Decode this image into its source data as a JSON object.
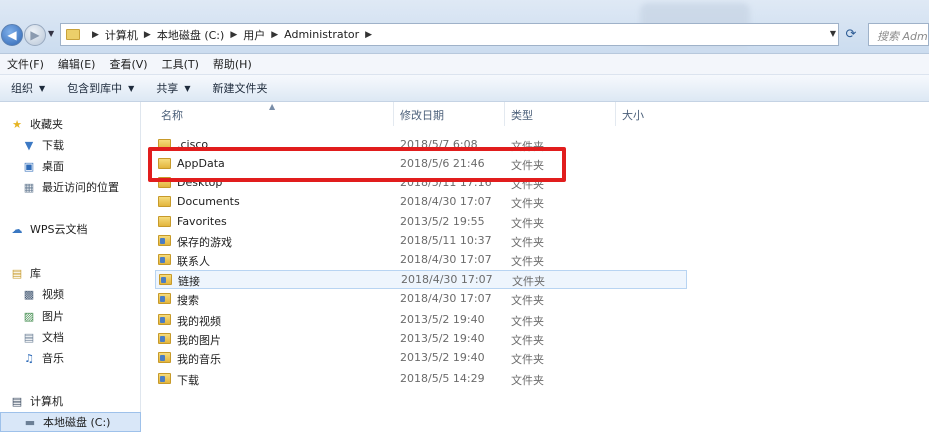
{
  "address_bar": {
    "crumbs": [
      "计算机",
      "本地磁盘 (C:)",
      "用户",
      "Administrator"
    ],
    "search_placeholder": "搜索 Administrator"
  },
  "menu": [
    "文件(F)",
    "编辑(E)",
    "查看(V)",
    "工具(T)",
    "帮助(H)"
  ],
  "commands": [
    {
      "label": "组织",
      "dropdown": true
    },
    {
      "label": "包含到库中",
      "dropdown": true
    },
    {
      "label": "共享",
      "dropdown": true
    },
    {
      "label": "新建文件夹",
      "dropdown": false
    }
  ],
  "nav": {
    "favorites": "收藏夹",
    "downloads": "下载",
    "desktop": "桌面",
    "recent": "最近访问的位置",
    "wps": "WPS云文档",
    "libraries": "库",
    "videos": "视频",
    "pictures": "图片",
    "documents": "文档",
    "music": "音乐",
    "computer": "计算机",
    "local_disk": "本地磁盘 (C:)"
  },
  "columns": {
    "name": "名称",
    "modified": "修改日期",
    "type": "类型",
    "size": "大小"
  },
  "files": [
    {
      "name": ".cisco",
      "date": "2018/5/7 6:08",
      "type": "文件夹",
      "special": false
    },
    {
      "name": "AppData",
      "date": "2018/5/6 21:46",
      "type": "文件夹",
      "special": false
    },
    {
      "name": "Desktop",
      "date": "2018/5/11 17:16",
      "type": "文件夹",
      "special": false
    },
    {
      "name": "Documents",
      "date": "2018/4/30 17:07",
      "type": "文件夹",
      "special": false
    },
    {
      "name": "Favorites",
      "date": "2013/5/2 19:55",
      "type": "文件夹",
      "special": false
    },
    {
      "name": "保存的游戏",
      "date": "2018/5/11 10:37",
      "type": "文件夹",
      "special": true
    },
    {
      "name": "联系人",
      "date": "2018/4/30 17:07",
      "type": "文件夹",
      "special": true
    },
    {
      "name": "链接",
      "date": "2018/4/30 17:07",
      "type": "文件夹",
      "special": true
    },
    {
      "name": "搜索",
      "date": "2018/4/30 17:07",
      "type": "文件夹",
      "special": true
    },
    {
      "name": "我的视频",
      "date": "2013/5/2 19:40",
      "type": "文件夹",
      "special": true
    },
    {
      "name": "我的图片",
      "date": "2013/5/2 19:40",
      "type": "文件夹",
      "special": true
    },
    {
      "name": "我的音乐",
      "date": "2013/5/2 19:40",
      "type": "文件夹",
      "special": true
    },
    {
      "name": "下载",
      "date": "2018/5/5 14:29",
      "type": "文件夹",
      "special": true
    }
  ],
  "highlight_color": "#e11d1d"
}
